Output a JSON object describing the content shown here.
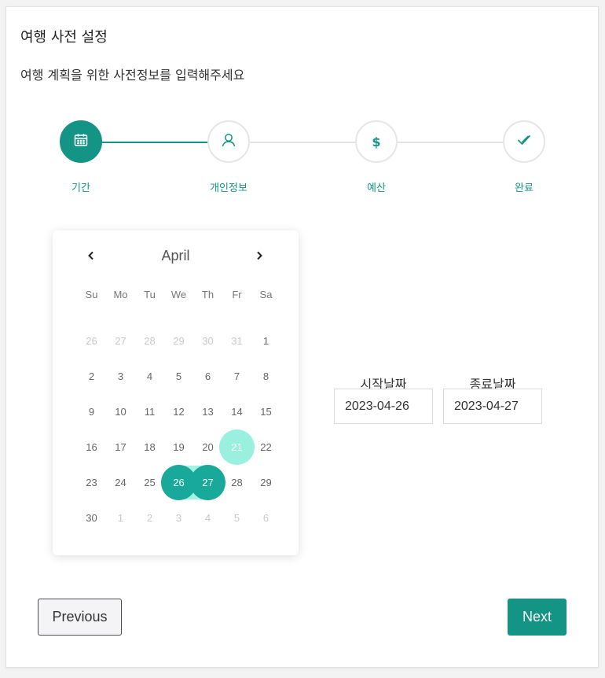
{
  "header": {
    "title": "여행 사전 설정",
    "subtitle": "여행 계획을 위한 사전정보를 입력해주세요"
  },
  "stepper": {
    "steps": [
      {
        "label": "기간",
        "icon": "calendar-icon",
        "state": "active"
      },
      {
        "label": "개인정보",
        "icon": "user-icon",
        "state": "pending"
      },
      {
        "label": "예산",
        "icon": "dollar-icon",
        "state": "pending"
      },
      {
        "label": "완료",
        "icon": "check-icon",
        "state": "pending"
      }
    ],
    "accent": "#149485"
  },
  "calendar": {
    "month": "April",
    "prev_glyph": "‹",
    "next_glyph": "›",
    "weekdays": [
      "Su",
      "Mo",
      "Tu",
      "We",
      "Th",
      "Fr",
      "Sa"
    ],
    "weeks": [
      [
        "26",
        "27",
        "28",
        "29",
        "30",
        "31",
        "1"
      ],
      [
        "2",
        "3",
        "4",
        "5",
        "6",
        "7",
        "8"
      ],
      [
        "9",
        "10",
        "11",
        "12",
        "13",
        "14",
        "15"
      ],
      [
        "16",
        "17",
        "18",
        "19",
        "20",
        "21",
        "22"
      ],
      [
        "23",
        "24",
        "25",
        "26",
        "27",
        "28",
        "29"
      ],
      [
        "30",
        "1",
        "2",
        "3",
        "4",
        "5",
        "6"
      ]
    ],
    "today": "21",
    "range_start": "26",
    "range_end": "27",
    "colors": {
      "selected": "#18a99a",
      "today": "#9af0df",
      "range": "#a3f2e2"
    }
  },
  "dates": {
    "start_label": "시작날짜",
    "start_value": "2023-04-26",
    "end_label": "종료날짜",
    "end_value": "2023-04-27"
  },
  "actions": {
    "previous": "Previous",
    "next": "Next"
  }
}
